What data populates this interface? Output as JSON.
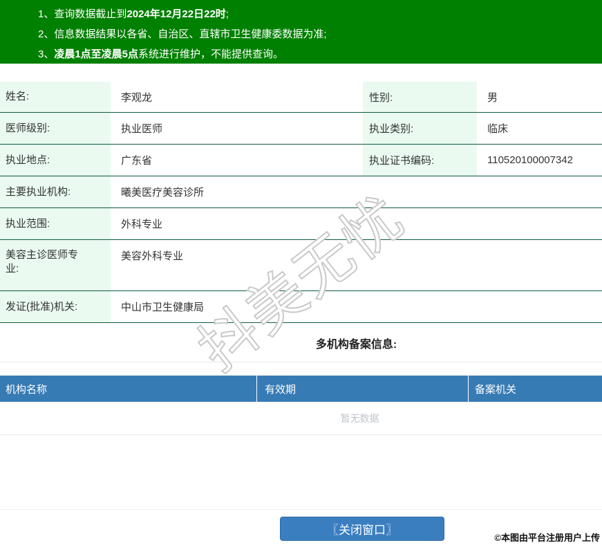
{
  "notice_banner": {
    "lines": [
      {
        "num": "1、",
        "pre": "查询数据截止到",
        "bold": "2024年12月22日22时",
        "post": ";"
      },
      {
        "num": "2、",
        "pre": "信息数据结果以各省、自治区、直辖市卫生健康委数据为准;",
        "bold": "",
        "post": ""
      },
      {
        "num": "3、",
        "pre": "",
        "bold": "凌晨1点至凌晨5点",
        "post": "系统进行维护，不能提供查询。"
      }
    ]
  },
  "doctor_info": {
    "name_label": "姓名:",
    "name_value": "李观龙",
    "gender_label": "性别:",
    "gender_value": "男",
    "level_label": "医师级别:",
    "level_value": "执业医师",
    "category_label": "执业类别:",
    "category_value": "临床",
    "place_label": "执业地点:",
    "place_value": "广东省",
    "cert_label": "执业证书编码:",
    "cert_value": "110520100007342",
    "org_label": "主要执业机构:",
    "org_value": "曦美医疗美容诊所",
    "scope_label": "执业范围:",
    "scope_value": "外科专业",
    "cosmetic_label": "美容主诊医师专业:",
    "cosmetic_value": "美容外科专业",
    "issuer_label": "发证(批准)机关:",
    "issuer_value": "中山市卫生健康局"
  },
  "multi_org": {
    "title": "多机构备案信息:",
    "columns": [
      "机构名称",
      "有效期",
      "备案机关"
    ],
    "empty_text": "暂无数据"
  },
  "footer": {
    "close_button_label": "〖关闭窗口〗",
    "attribution": "©本图由平台注册用户上传"
  },
  "watermark": {
    "text": "抖美无忧"
  },
  "colors": {
    "banner_green": "#008000",
    "row_border_green": "#0a5c3c",
    "label_bg_mint": "#eafaf1",
    "table_header_blue": "#377bb5",
    "button_blue": "#3a7ec0",
    "empty_text_gray": "#c0c4cc"
  }
}
